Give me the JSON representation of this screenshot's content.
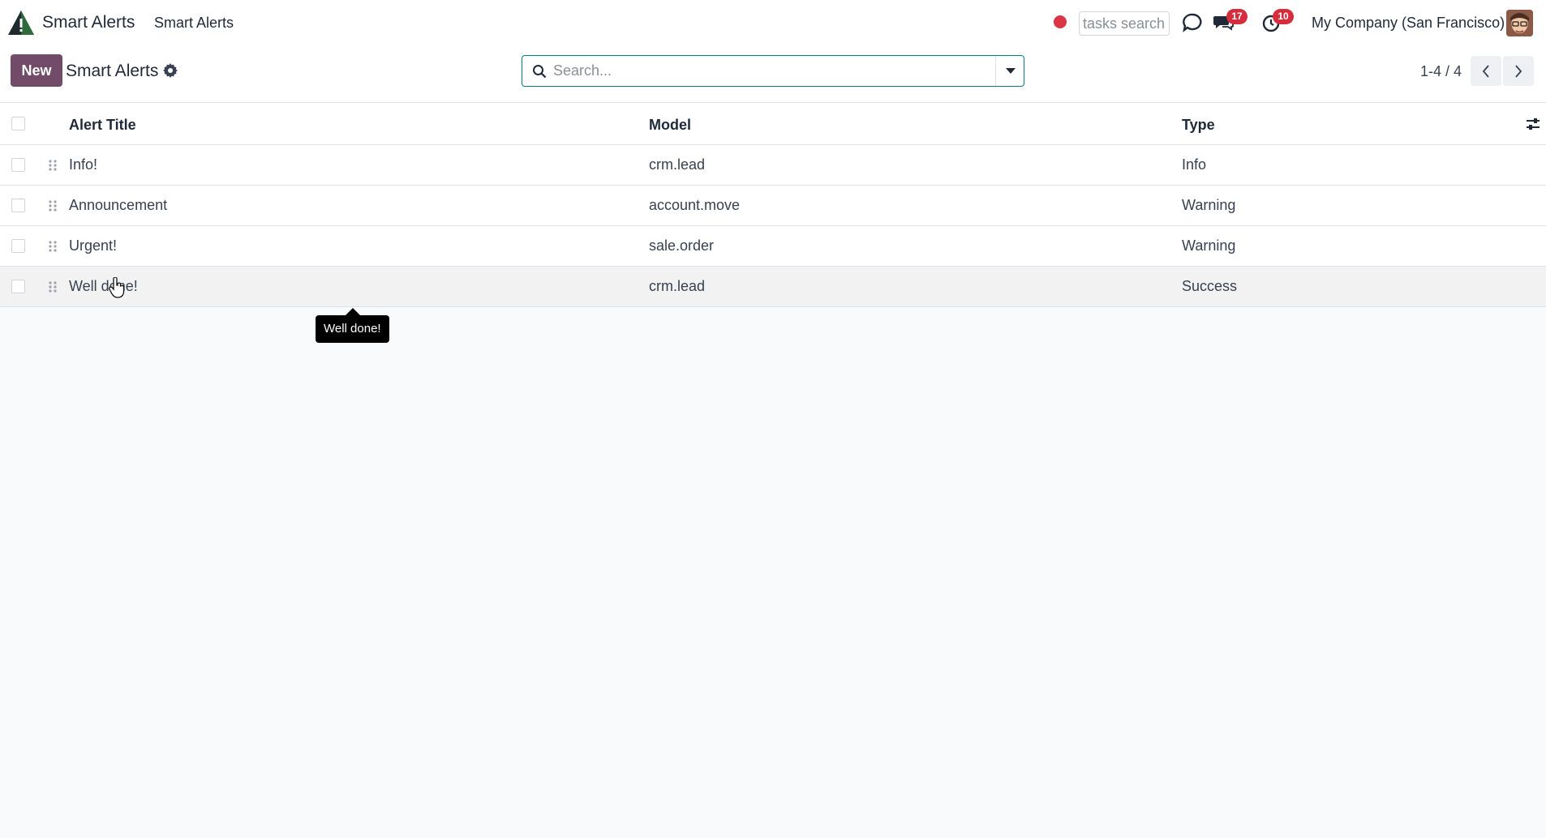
{
  "navbar": {
    "app_name": "Smart Alerts",
    "menu_item": "Smart Alerts",
    "tasks_search_placeholder": "tasks search",
    "messages_count": "17",
    "activities_count": "10",
    "company": "My Company (San Francisco)"
  },
  "control_panel": {
    "new_label": "New",
    "title": "Smart Alerts",
    "search_placeholder": "Search...",
    "pager": "1-4 / 4"
  },
  "table": {
    "columns": [
      "Alert Title",
      "Model",
      "Type"
    ],
    "rows": [
      {
        "title": "Info!",
        "model": "crm.lead",
        "type": "Info"
      },
      {
        "title": "Announcement",
        "model": "account.move",
        "type": "Warning"
      },
      {
        "title": "Urgent!",
        "model": "sale.order",
        "type": "Warning"
      },
      {
        "title": "Well done!",
        "model": "crm.lead",
        "type": "Success"
      }
    ]
  },
  "tooltip": {
    "text": "Well done!"
  },
  "colors": {
    "brand": "#714b67",
    "accent": "#017e84",
    "badge": "#d62d3c",
    "record": "#dc3545"
  }
}
